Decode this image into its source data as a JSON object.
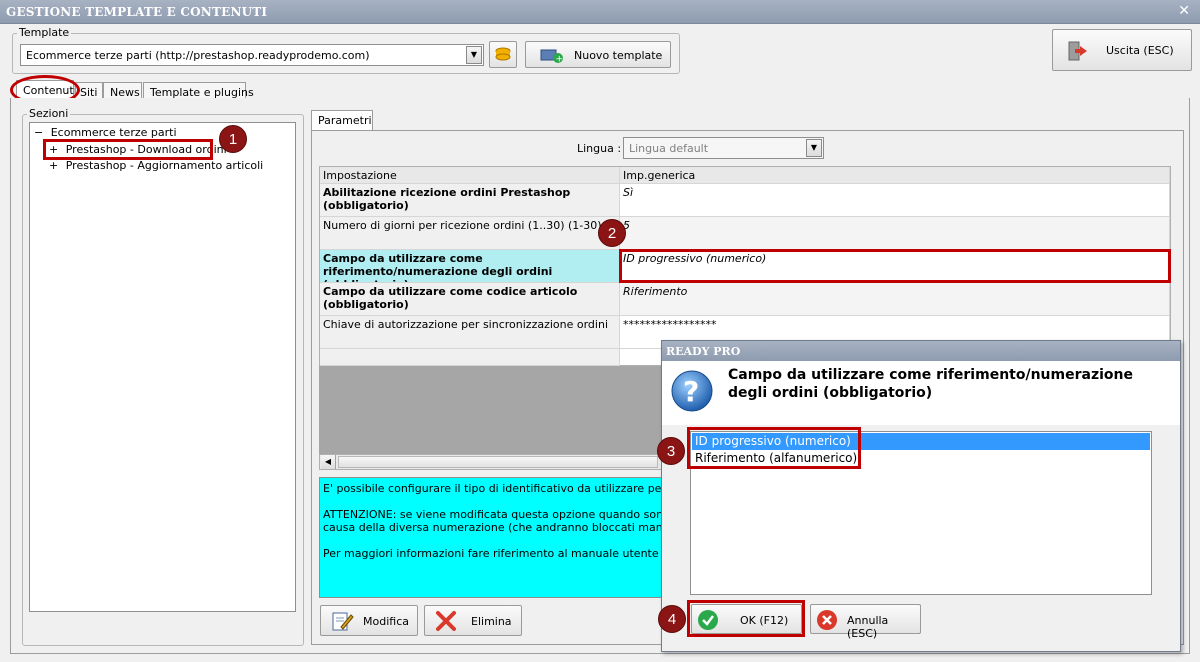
{
  "window": {
    "title": "GESTIONE TEMPLATE E CONTENUTI",
    "close_glyph": "✕"
  },
  "template_group": {
    "label": "Template",
    "selected": "Ecommerce terze parti (http://prestashop.readyprodemo.com)",
    "new_template_label": "Nuovo template"
  },
  "exit_button": {
    "label": "Uscita (ESC)"
  },
  "tabs": [
    {
      "label": "Contenuti"
    },
    {
      "label": "Siti"
    },
    {
      "label": "News"
    },
    {
      "label": "Template e plugins"
    }
  ],
  "sections": {
    "label": "Sezioni",
    "root": {
      "expander": "−",
      "label": "Ecommerce terze parti"
    },
    "children": [
      {
        "expander": "+",
        "label": "Prestashop - Download ordini"
      },
      {
        "expander": "+",
        "label": "Prestashop - Aggiornamento articoli"
      }
    ]
  },
  "params": {
    "tab_label": "Parametri",
    "lingua_label": "Lingua :",
    "lingua_value": "Lingua default",
    "headers": {
      "setting": "Impostazione",
      "value": "Imp.generica"
    },
    "rows": [
      {
        "setting": "Abilitazione ricezione ordini Prestashop (obbligatorio)",
        "value": "Sì"
      },
      {
        "setting": "Numero di giorni per ricezione ordini (1..30) (1-30)",
        "value": "5"
      },
      {
        "setting": "Campo da utilizzare come riferimento/numerazione degli ordini (obbligatorio)",
        "value": "ID progressivo (numerico)"
      },
      {
        "setting": "Campo da utilizzare come codice articolo (obbligatorio)",
        "value": "Riferimento"
      },
      {
        "setting": "Chiave di autorizzazione per sincronizzazione ordini",
        "value": "*****************"
      }
    ],
    "info_lines": [
      "E' possibile configurare il tipo di identificativo da utilizzare per gli ordini i",
      "ATTENZIONE: se viene modificata questa opzione quando sono stati gia",
      "causa della diversa numerazione (che andranno bloccati manualmente)",
      "Per maggiori informazioni fare riferimento al manuale utente"
    ],
    "modify_label": "Modifica",
    "delete_label": "Elimina"
  },
  "dialog": {
    "title": "READY PRO",
    "question": "Campo da utilizzare come riferimento/numerazione degli ordini (obbligatorio)",
    "options": [
      "ID progressivo (numerico)",
      "Riferimento (alfanumerico)"
    ],
    "ok_label": "OK (F12)",
    "cancel_label": "Annulla (ESC)"
  },
  "markers": [
    "1",
    "2",
    "3",
    "4"
  ],
  "colors": {
    "selection": "#3399ff",
    "highlight_row": "#b0eef2",
    "info_bg": "#00ffff",
    "annotation_red": "#c00000"
  }
}
